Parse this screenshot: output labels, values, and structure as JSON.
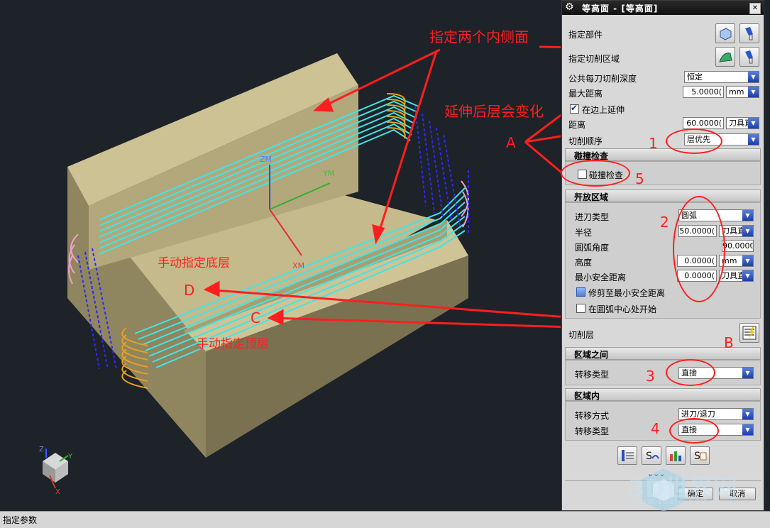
{
  "dialog": {
    "title": "等高面 - [等高面]",
    "specify_part": "指定部件",
    "specify_cut_area": "指定切削区域",
    "common_depth_label": "公共每刀切削深度",
    "common_depth_value": "恒定",
    "max_distance_label": "最大距离",
    "max_distance_value": "5.0000(",
    "max_distance_unit": "mm",
    "extend_edges_label": "在边上延伸",
    "distance_label": "距离",
    "distance_value": "60.0000(",
    "distance_unit": "刀具直",
    "cut_order_label": "切削顺序",
    "cut_order_value": "层优先",
    "collision": {
      "header": "碰撞检查",
      "checkbox_label": "碰撞检查"
    },
    "open_area": {
      "header": "开放区域",
      "engage_type_label": "进刀类型",
      "engage_type_value": "圆弧",
      "radius_label": "半径",
      "radius_value": "50.0000(",
      "radius_unit": "刀具直",
      "arc_angle_label": "圆弧角度",
      "arc_angle_value": "90.0000(",
      "height_label": "高度",
      "height_value": "0.0000(",
      "height_unit": "mm",
      "min_clearance_label": "最小安全距离",
      "min_clearance_value": "0.0000(",
      "min_clearance_unit": "刀具直",
      "trim_label": "修剪至最小安全距离",
      "arc_center_label": "在圆弧中心处开始"
    },
    "cut_levels_label": "切削层",
    "between_regions": {
      "header": "区域之间",
      "transfer_type_label": "转移类型",
      "transfer_type_value": "直接"
    },
    "within_region": {
      "header": "区域内",
      "transfer_method_label": "转移方式",
      "transfer_method_value": "进刀/退刀",
      "transfer_type_label": "转移类型",
      "transfer_type_value": "直接"
    },
    "more_chevrons": "⌄⌄⌄",
    "ok": "确定",
    "cancel": "取消"
  },
  "viewport": {
    "axis_zm": "ZM",
    "axis_ym": "YM",
    "axis_xm": "XM",
    "triad_z": "Z",
    "triad_y": "Y",
    "triad_x": "X"
  },
  "annotations": {
    "two_inner_faces": "指定两个内侧面",
    "extend_note": "延伸后层会变化",
    "manual_bottom": "手动指定底层",
    "manual_top": "手动指定顶层",
    "A": "A",
    "B": "B",
    "C": "C",
    "D": "D",
    "n1": "1",
    "n2": "2",
    "n3": "3",
    "n4": "4",
    "n5": "5"
  },
  "watermark": "3D世界网",
  "watermark_url": "WWW.3DSJW.COM",
  "status_text": "指定参数",
  "colors": {
    "annotation": "#ff1e1e",
    "block_top": "#c9bd8c",
    "toolpath": "#3ee6e6",
    "dialog_bg": "#d8d8d8"
  }
}
